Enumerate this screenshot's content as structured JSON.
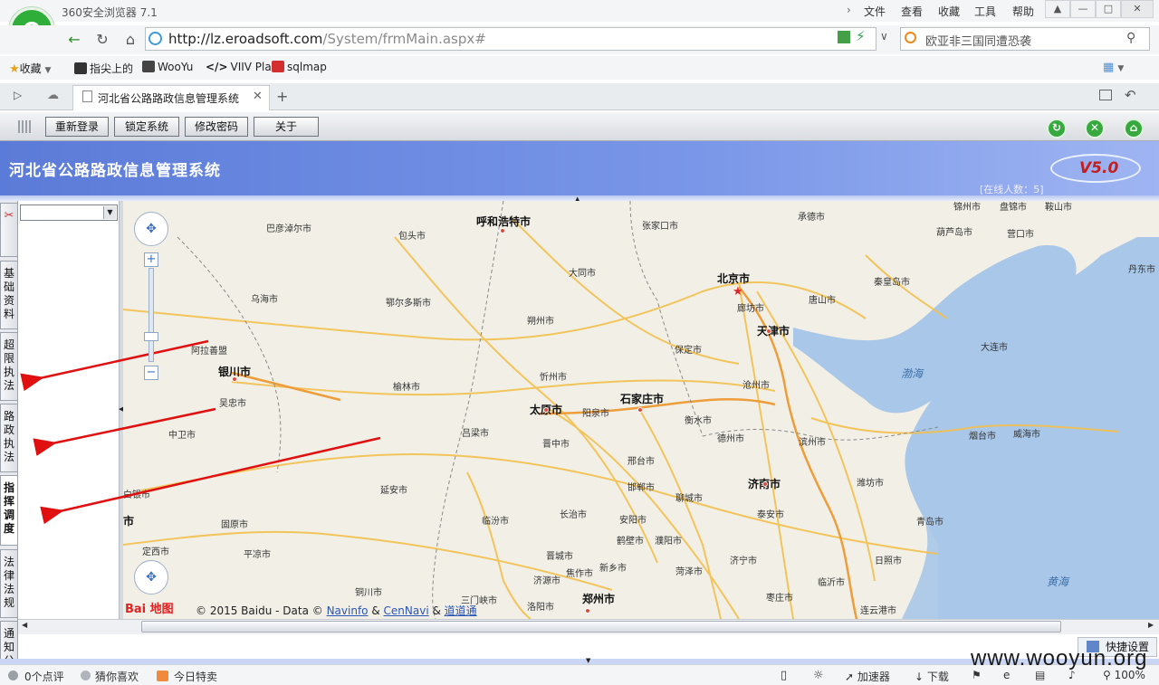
{
  "browser": {
    "app_name": "360安全浏览器 7.1",
    "logo_letter": "e",
    "menu": [
      "文件",
      "查看",
      "收藏",
      "工具",
      "帮助"
    ],
    "url_host": "http://lz.eroadsoft.com",
    "url_path": "/System/frmMain.aspx#",
    "search_text": "欧亚非三国同遭恐袭",
    "favorites_label": "收藏",
    "favorites": [
      "指尖上的",
      "WooYu",
      "VIIV Pla",
      "sqlmap"
    ],
    "tab_title": "河北省公路路政信息管理系统",
    "new_tab": "+"
  },
  "toolbar": {
    "buttons": [
      "重新登录",
      "锁定系统",
      "修改密码",
      "关于"
    ]
  },
  "banner": {
    "title": "河北省公路路政信息管理系统",
    "version": "V5.0",
    "online": "[在线人数：5]"
  },
  "left_tabs": [
    "基础资料",
    "超限执法",
    "路政执法",
    "指挥调度",
    "法律法规",
    "通知公告"
  ],
  "map": {
    "cities_big": [
      "呼和浩特市",
      "北京市",
      "天津市",
      "太原市",
      "石家庄市",
      "济南市",
      "郑州市",
      "银川市"
    ],
    "cities": [
      "巴彦淖尔市",
      "包头市",
      "张家口市",
      "承德市",
      "锦州市",
      "盘锦市",
      "鞍山市",
      "葫芦岛市",
      "营口市",
      "丹东市",
      "乌海市",
      "大同市",
      "秦皇岛市",
      "鄂尔多斯市",
      "朔州市",
      "廊坊市",
      "唐山市",
      "阿拉善盟",
      "保定市",
      "大连市",
      "忻州市",
      "沧州市",
      "吴忠市",
      "榆林市",
      "阳泉市",
      "衡水市",
      "中卫市",
      "吕梁市",
      "晋中市",
      "德州市",
      "滨州市",
      "烟台市",
      "威海市",
      "邢台市",
      "邯郸市",
      "潍坊市",
      "延安市",
      "聊城市",
      "固原市",
      "临汾市",
      "长治市",
      "安阳市",
      "泰安市",
      "青岛市",
      "平凉市",
      "晋城市",
      "鹤壁市",
      "濮阳市",
      "定西市",
      "焦作市",
      "新乡市",
      "菏泽市",
      "济宁市",
      "日照市",
      "济源市",
      "铜川市",
      "三门峡市",
      "洛阳市",
      "枣庄市",
      "临沂市",
      "连云港市"
    ],
    "seas": [
      "渤海",
      "黄海"
    ],
    "copyright_prefix": "© 2015 Baidu - Data ©",
    "copyright_links": [
      "Navinfo",
      "CenNavi",
      "道道通"
    ],
    "baidu_logo": "Bai 地图"
  },
  "quick_settings": "快捷设置",
  "status": {
    "reviews": "0个点评",
    "guess": "猜你喜欢",
    "deals": "今日特卖",
    "accelerator": "加速器",
    "download": "下载",
    "zoom": "100%"
  },
  "watermark": "www.wooyun.org",
  "colors": {
    "banner_blue": "#5b7bd8",
    "annotation_red": "#e01010",
    "logo_green": "#2fae3a"
  }
}
